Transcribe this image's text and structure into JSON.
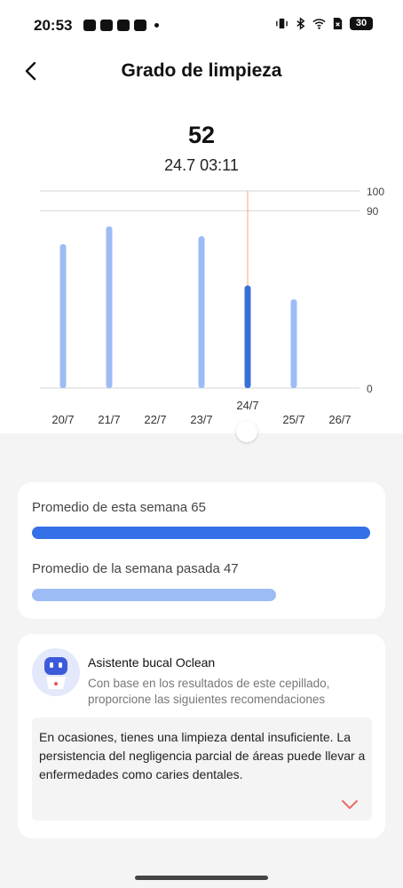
{
  "status": {
    "time": "20:53",
    "battery": "30"
  },
  "header": {
    "title": "Grado de limpieza"
  },
  "selected": {
    "value": "52",
    "datetime": "24.7  03:11"
  },
  "chart_data": {
    "type": "bar",
    "categories": [
      "20/7",
      "21/7",
      "22/7",
      "23/7",
      "24/7",
      "25/7",
      "26/7"
    ],
    "values": [
      73,
      82,
      0,
      77,
      52,
      45,
      0
    ],
    "selected_index": 4,
    "ylim": [
      0,
      100
    ],
    "yticks": [
      "100",
      "90",
      "0"
    ],
    "colors": {
      "bar": "#9dbcf6",
      "selected": "#3a6fd8",
      "cursor": "#f0a97a"
    }
  },
  "averages": {
    "this_week_label": "Promedio de esta semana 65",
    "this_week_value": 65,
    "last_week_label": "Promedio de la semana pasada 47",
    "last_week_value": 47
  },
  "assistant": {
    "title": "Asistente bucal Oclean",
    "subtitle": "Con base en los resultados de este cepillado, proporcione las siguientes recomendaciones",
    "advice": "En ocasiones, tienes una limpieza dental insuficiente. La persistencia del negligencia parcial de áreas puede llevar a enfermedades como caries dentales."
  }
}
